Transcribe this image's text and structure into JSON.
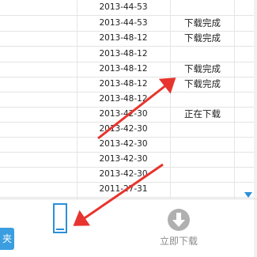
{
  "rows": [
    {
      "date": "2013-44-53",
      "status": ""
    },
    {
      "date": "2013-44-53",
      "status": "下载完成"
    },
    {
      "date": "2013-48-12",
      "status": "下载完成"
    },
    {
      "date": "2013-48-12",
      "status": ""
    },
    {
      "date": "2013-48-12",
      "status": "下载完成"
    },
    {
      "date": "2013-48-12",
      "status": "下载完成"
    },
    {
      "date": "2013-48-12",
      "status": ""
    },
    {
      "date": "2013-42-30",
      "status": "正在下载"
    },
    {
      "date": "2013-42-30",
      "status": ""
    },
    {
      "date": "2013-42-30",
      "status": ""
    },
    {
      "date": "2013-42-30",
      "status": ""
    },
    {
      "date": "2013-42-30",
      "status": ""
    },
    {
      "date": "2011-27-31",
      "status": ""
    }
  ],
  "toolbar": {
    "left_button_label": "夹",
    "download_now_label": "立即下载"
  },
  "colors": {
    "accent": "#3a9ee0",
    "arrow": "#e8342e",
    "icon_gray": "#b0b0b0"
  },
  "icons": {
    "download": "download-arrow-icon",
    "scroll_down": "scroll-down-arrow-icon"
  }
}
